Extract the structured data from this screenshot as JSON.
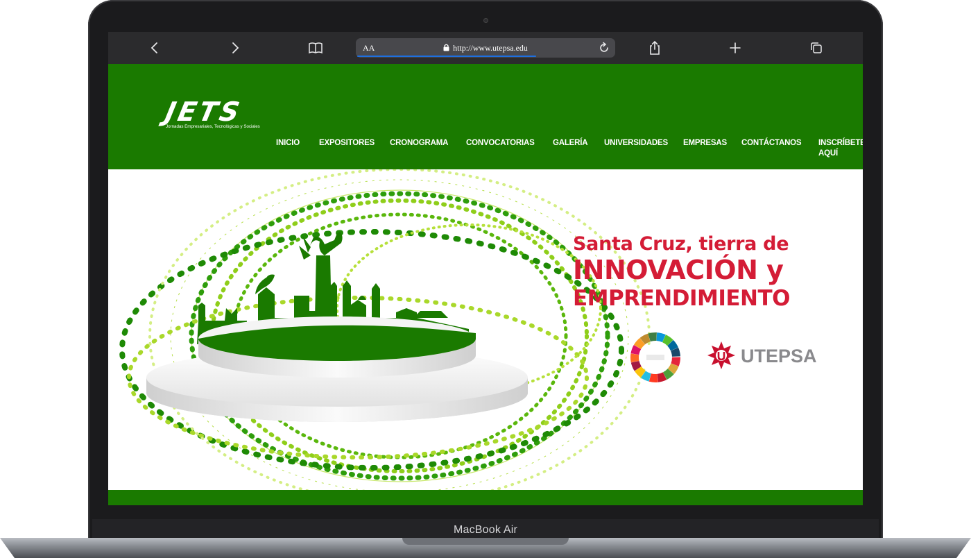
{
  "device": {
    "label": "MacBook Air"
  },
  "browser": {
    "text_size_button": "AA",
    "url": "http://www.utepsa.edu",
    "icons": [
      "back-icon",
      "forward-icon",
      "bookmarks-icon",
      "lock-icon",
      "reload-icon",
      "share-icon",
      "new-tab-icon",
      "tabs-icon"
    ]
  },
  "site": {
    "logo": {
      "title": "JETS",
      "subtitle": "Jornadas Empresariales, Tecnológicas y Sociales"
    },
    "nav": [
      {
        "label": "INICIO"
      },
      {
        "label": "EXPOSITORES"
      },
      {
        "label": "CRONOGRAMA"
      },
      {
        "label": "CONVOCATORIAS"
      },
      {
        "label": "GALERÍA"
      },
      {
        "label": "UNIVERSIDADES"
      },
      {
        "label": "EMPRESAS"
      },
      {
        "label": "CONTÁCTANOS"
      },
      {
        "label": "INSCRÍBETE",
        "label2": "AQUÍ"
      }
    ],
    "hero": {
      "line1": "Santa Cruz, tierra de",
      "line2": "INNOVACIÓN y",
      "line3": "EMPRENDIMIENTO",
      "partner_logo": "UTEPSA",
      "ods_badge": "OBJETIVOS DE DESARROLLO SOSTENIBLE"
    }
  },
  "colors": {
    "header_green": "#1a7a00",
    "headline_red": "#d41c36",
    "toolbar": "#2b2b2d"
  }
}
